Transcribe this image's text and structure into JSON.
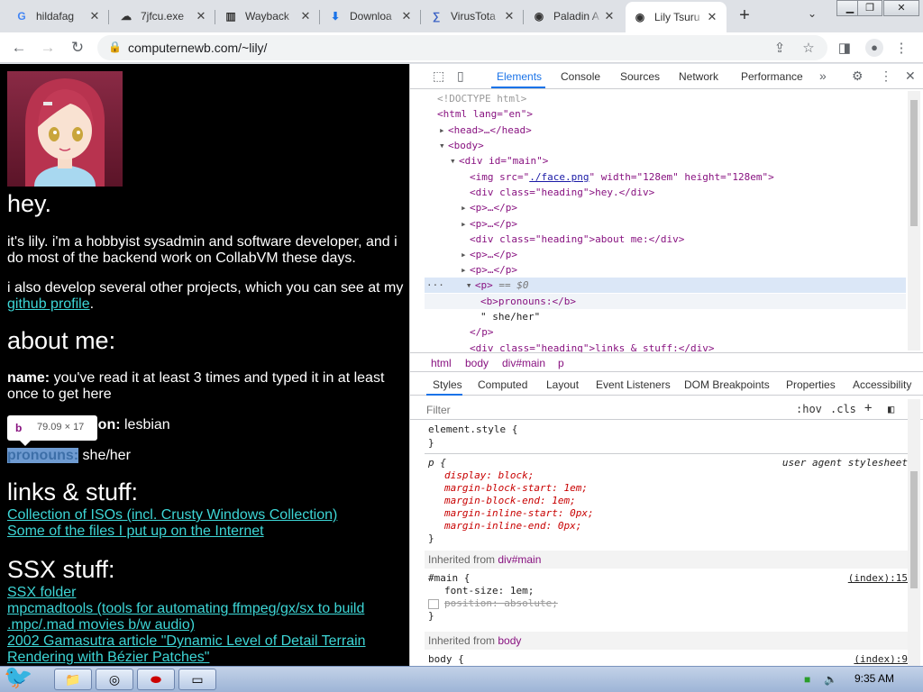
{
  "tabs": [
    {
      "label": "hildafag",
      "icon": "G",
      "color": "#4285f4"
    },
    {
      "label": "7jfcu.exe",
      "icon": "☁",
      "color": "#222"
    },
    {
      "label": "Wayback",
      "icon": "▥",
      "color": "#222"
    },
    {
      "label": "Downloa",
      "icon": "⬇",
      "color": "#1a73e8"
    },
    {
      "label": "VirusTota",
      "icon": "∑",
      "color": "#3b61c4"
    },
    {
      "label": "Paladin A",
      "icon": "◉",
      "color": "#555"
    },
    {
      "label": "Lily Tsuru",
      "icon": "◉",
      "color": "#333"
    }
  ],
  "toolbar": {
    "url": "computernewb.com/~lily/"
  },
  "page": {
    "heading1": "hey.",
    "intro_p1": "it's lily. i'm a hobbyist sysadmin and software developer, and i do most of the backend work on CollabVM these days.",
    "intro_p2_prefix": "i also develop several other projects, which you can see at my ",
    "github_link": "github profile",
    "intro_p2_suffix": ".",
    "heading2": "about me:",
    "name_label": "name:",
    "name_value": " you've read it at least 3 times and typed it in at least once to get here",
    "orientation_label_visible": "ation:",
    "orientation_value": " lesbian",
    "pronouns_label": "pronouns:",
    "pronouns_value": " she/her",
    "heading3": "links & stuff:",
    "links": [
      "Collection of ISOs (incl. Crusty Windows Collection)",
      "Some of the files I put up on the Internet"
    ],
    "heading4": "SSX stuff:",
    "ssx_links": [
      "SSX folder",
      "mpcmadtools (tools for automating ffmpeg/gx/sx to build .mpc/.mad movies b/w audio)",
      "2002 Gamasutra article \"Dynamic Level of Detail Terrain Rendering with Bézier Patches\""
    ],
    "tooltip_tag": "b",
    "tooltip_size": "79.09 × 17"
  },
  "devtools": {
    "tabs": [
      "Elements",
      "Console",
      "Sources",
      "Network",
      "Performance"
    ],
    "tree": {
      "doctype": "<!DOCTYPE html>",
      "html_open": "<html lang=\"en\">",
      "head": "<head>…</head>",
      "body": "<body>",
      "div_main": "<div id=\"main\">",
      "img": "<img src=\"",
      "img_src": "./face.png",
      "img_rest": "\" width=\"128em\" height=\"128em\">",
      "div_heading_hey": "<div class=\"heading\">hey.</div>",
      "p_collapsed": "<p>…</p>",
      "div_heading_about": "<div class=\"heading\">about me:</div>",
      "p_selected": "<p>",
      "selected_marker": " == $0",
      "b_pronouns": "<b>pronouns:</b>",
      "she_her": "\" she/her\"",
      "p_close": "</p>",
      "div_heading_links": "<div class=\"heading\">links & stuff:</div>"
    },
    "breadcrumbs": [
      "html",
      "body",
      "div#main",
      "p"
    ],
    "style_tabs": [
      "Styles",
      "Computed",
      "Layout",
      "Event Listeners",
      "DOM Breakpoints",
      "Properties",
      "Accessibility"
    ],
    "filter_placeholder": "Filter",
    "hov": ":hov",
    "cls": ".cls",
    "styles": {
      "element_style": "element.style {",
      "close": "}",
      "p_rule": "p {",
      "ua_label": "user agent stylesheet",
      "p_props": [
        "display: block;",
        "margin-block-start: 1em;",
        "margin-block-end: 1em;",
        "margin-inline-start: 0px;",
        "margin-inline-end: 0px;"
      ],
      "inherited1_prefix": "Inherited from ",
      "inherited1_from": "div#main",
      "main_rule": "#main {",
      "main_src": "(index):15",
      "main_props": [
        "font-size: 1em;",
        "position: absolute;"
      ],
      "inherited2_prefix": "Inherited from ",
      "inherited2_from": "body",
      "body_rule": "body {",
      "body_src": "(index):9"
    }
  },
  "taskbar": {
    "clock": "9:35 AM"
  }
}
